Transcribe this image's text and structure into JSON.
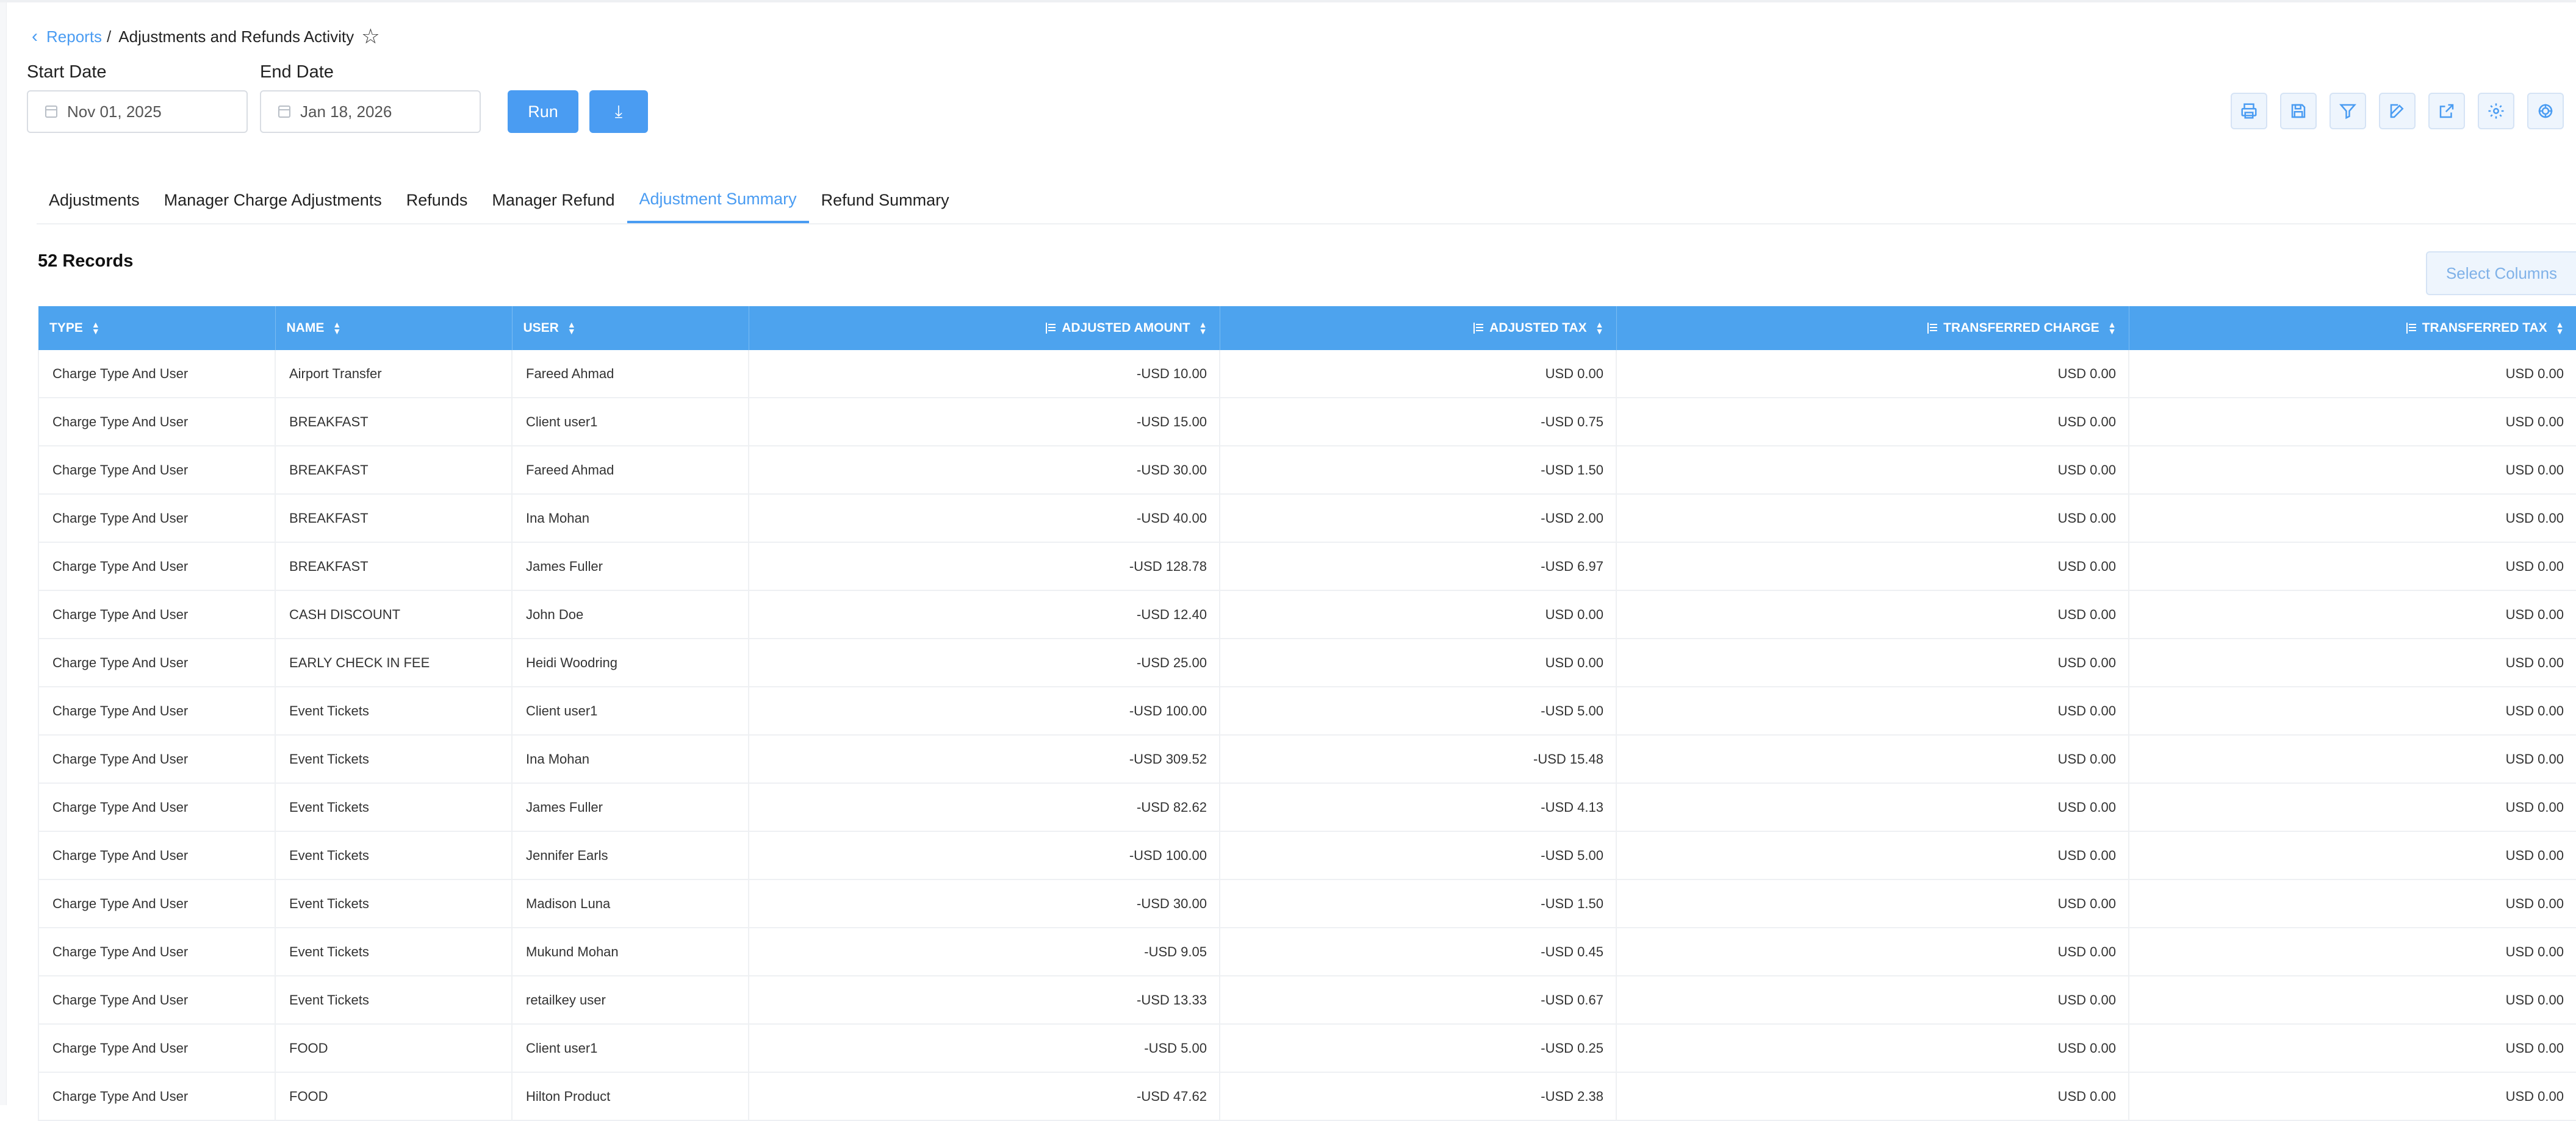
{
  "breadcrumb": {
    "parent": "Reports",
    "separator": "/",
    "title": "Adjustments and Refunds Activity"
  },
  "filters": {
    "start_label": "Start Date",
    "start_value": "Nov 01, 2025",
    "end_label": "End Date",
    "end_value": "Jan 18, 2026",
    "run_label": "Run"
  },
  "toolbar": {
    "icons": [
      "print-icon",
      "save-icon",
      "filter-icon",
      "edit-icon",
      "share-icon",
      "settings-icon",
      "manage-icon"
    ]
  },
  "tabs": [
    {
      "label": "Adjustments",
      "active": false
    },
    {
      "label": "Manager Charge Adjustments",
      "active": false
    },
    {
      "label": "Refunds",
      "active": false
    },
    {
      "label": "Manager Refund",
      "active": false
    },
    {
      "label": "Adjustment Summary",
      "active": true
    },
    {
      "label": "Refund Summary",
      "active": false
    }
  ],
  "records_label": "52 Records",
  "select_columns_label": "Select Columns",
  "table": {
    "headers": [
      "TYPE",
      "NAME",
      "USER",
      "ADJUSTED AMOUNT",
      "ADJUSTED TAX",
      "TRANSFERRED CHARGE",
      "TRANSFERRED TAX"
    ],
    "rows": [
      [
        "Charge Type And User",
        "Airport Transfer",
        "Fareed Ahmad",
        "-USD 10.00",
        "USD 0.00",
        "USD 0.00",
        "USD 0.00"
      ],
      [
        "Charge Type And User",
        "BREAKFAST",
        "Client user1",
        "-USD 15.00",
        "-USD 0.75",
        "USD 0.00",
        "USD 0.00"
      ],
      [
        "Charge Type And User",
        "BREAKFAST",
        "Fareed Ahmad",
        "-USD 30.00",
        "-USD 1.50",
        "USD 0.00",
        "USD 0.00"
      ],
      [
        "Charge Type And User",
        "BREAKFAST",
        "Ina Mohan",
        "-USD 40.00",
        "-USD 2.00",
        "USD 0.00",
        "USD 0.00"
      ],
      [
        "Charge Type And User",
        "BREAKFAST",
        "James Fuller",
        "-USD 128.78",
        "-USD 6.97",
        "USD 0.00",
        "USD 0.00"
      ],
      [
        "Charge Type And User",
        "CASH DISCOUNT",
        "John Doe",
        "-USD 12.40",
        "USD 0.00",
        "USD 0.00",
        "USD 0.00"
      ],
      [
        "Charge Type And User",
        "EARLY CHECK IN FEE",
        "Heidi Woodring",
        "-USD 25.00",
        "USD 0.00",
        "USD 0.00",
        "USD 0.00"
      ],
      [
        "Charge Type And User",
        "Event Tickets",
        "Client user1",
        "-USD 100.00",
        "-USD 5.00",
        "USD 0.00",
        "USD 0.00"
      ],
      [
        "Charge Type And User",
        "Event Tickets",
        "Ina Mohan",
        "-USD 309.52",
        "-USD 15.48",
        "USD 0.00",
        "USD 0.00"
      ],
      [
        "Charge Type And User",
        "Event Tickets",
        "James Fuller",
        "-USD 82.62",
        "-USD 4.13",
        "USD 0.00",
        "USD 0.00"
      ],
      [
        "Charge Type And User",
        "Event Tickets",
        "Jennifer Earls",
        "-USD 100.00",
        "-USD 5.00",
        "USD 0.00",
        "USD 0.00"
      ],
      [
        "Charge Type And User",
        "Event Tickets",
        "Madison Luna",
        "-USD 30.00",
        "-USD 1.50",
        "USD 0.00",
        "USD 0.00"
      ],
      [
        "Charge Type And User",
        "Event Tickets",
        "Mukund Mohan",
        "-USD 9.05",
        "-USD 0.45",
        "USD 0.00",
        "USD 0.00"
      ],
      [
        "Charge Type And User",
        "Event Tickets",
        "retailkey user",
        "-USD 13.33",
        "-USD 0.67",
        "USD 0.00",
        "USD 0.00"
      ],
      [
        "Charge Type And User",
        "FOOD",
        "Client user1",
        "-USD 5.00",
        "-USD 0.25",
        "USD 0.00",
        "USD 0.00"
      ],
      [
        "Charge Type And User",
        "FOOD",
        "Hilton Product",
        "-USD 47.62",
        "-USD 2.38",
        "USD 0.00",
        "USD 0.00"
      ]
    ]
  },
  "colors": {
    "accent": "#4a9cf2",
    "header_bg": "#4da3ee"
  }
}
